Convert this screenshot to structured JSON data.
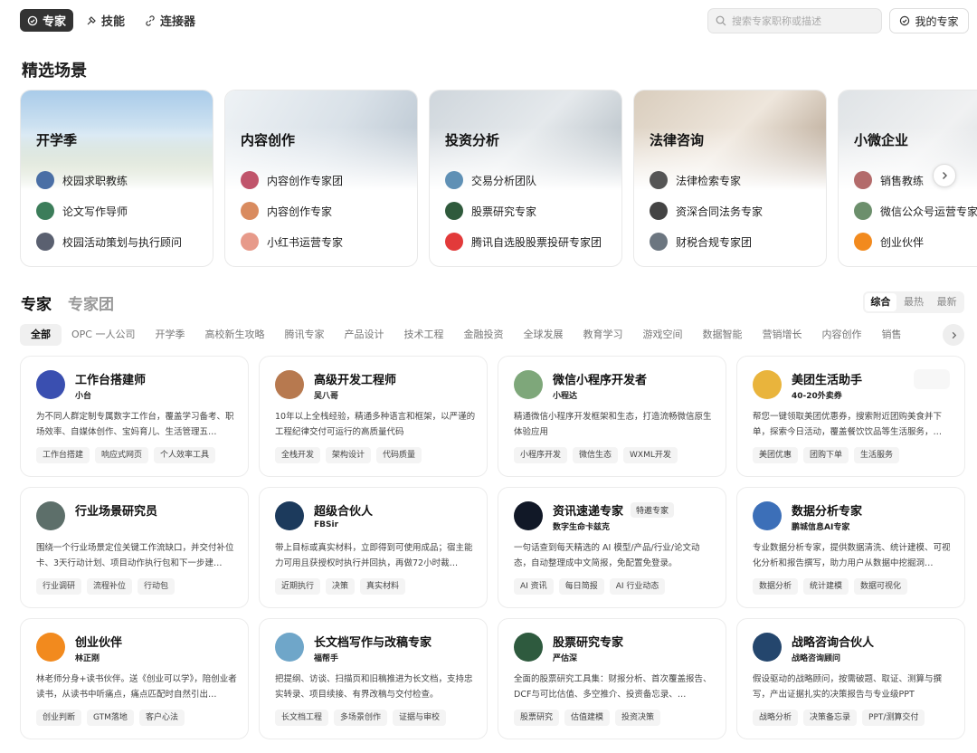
{
  "topnav": [
    {
      "label": "专家",
      "icon": "expert-icon",
      "active": true
    },
    {
      "label": "技能",
      "icon": "skill-icon",
      "active": false
    },
    {
      "label": "连接器",
      "icon": "link-icon",
      "active": false
    }
  ],
  "search": {
    "placeholder": "搜索专家职称或描述"
  },
  "my_experts": {
    "label": "我的专家"
  },
  "featured": {
    "title": "精选场景",
    "scenes": [
      {
        "title": "开学季",
        "items": [
          "校园求职教练",
          "论文写作导师",
          "校园活动策划与执行顾问"
        ]
      },
      {
        "title": "内容创作",
        "items": [
          "内容创作专家团",
          "内容创作专家",
          "小红书运营专家"
        ]
      },
      {
        "title": "投资分析",
        "items": [
          "交易分析团队",
          "股票研究专家",
          "腾讯自选股股票投研专家团"
        ]
      },
      {
        "title": "法律咨询",
        "items": [
          "法律检索专家",
          "资深合同法务专家",
          "财税合规专家团"
        ]
      },
      {
        "title": "小微企业",
        "items": [
          "销售教练",
          "微信公众号运营专家",
          "创业伙伴"
        ]
      }
    ]
  },
  "list_tabs": {
    "experts": "专家",
    "teams": "专家团"
  },
  "sort": {
    "overall": "综合",
    "hot": "最热",
    "newest": "最新"
  },
  "categories": [
    "全部",
    "OPC 一人公司",
    "开学季",
    "高校新生攻略",
    "腾讯专家",
    "产品设计",
    "技术工程",
    "金融投资",
    "全球发展",
    "教育学习",
    "游戏空间",
    "数据智能",
    "营销增长",
    "内容创作",
    "销售"
  ],
  "experts": [
    {
      "name": "工作台搭建师",
      "sub": "小台",
      "desc": "为不同人群定制专属数字工作台，覆盖学习备考、职场效率、自媒体创作、宝妈育儿、生活管理五…",
      "tags": [
        "工作台搭建",
        "响应式网页",
        "个人效率工具"
      ]
    },
    {
      "name": "高级开发工程师",
      "sub": "吴八哥",
      "desc": "10年以上全栈经验，精通多种语言和框架，以严谨的工程纪律交付可运行的高质量代码",
      "tags": [
        "全栈开发",
        "架构设计",
        "代码质量"
      ]
    },
    {
      "name": "微信小程序开发者",
      "sub": "小程达",
      "desc": "精通微信小程序开发框架和生态，打造流畅微信原生体验应用",
      "tags": [
        "小程序开发",
        "微信生态",
        "WXML开发"
      ]
    },
    {
      "name": "美团生活助手",
      "sub": "40-20外卖券",
      "desc": "帮您一键领取美团优惠券，搜索附近团购美食并下单，探索今日活动，覆盖餐饮饮品等生活服务，…",
      "tags": [
        "美团优惠",
        "团购下单",
        "生活服务"
      ]
    },
    {
      "name": "行业场景研究员",
      "sub": "",
      "desc": "围绕一个行业场景定位关键工作流缺口，并交付补位卡、3天行动计划、项目动作执行包和下一步建…",
      "tags": [
        "行业调研",
        "流程补位",
        "行动包"
      ]
    },
    {
      "name": "超级合伙人",
      "sub": "FBSir",
      "desc": "带上目标或真实材料，立即得到可使用成品；宿主能力可用且获授权时执行并回执，再做72小时裁…",
      "tags": [
        "近期执行",
        "决策",
        "真实材料"
      ]
    },
    {
      "name": "资讯速递专家",
      "badge": "特邀专家",
      "sub": "数字生命卡兹克",
      "desc": "一句话查到每天精选的 AI 模型/产品/行业/论文动态，自动整理成中文简报，免配置免登录。",
      "tags": [
        "AI 资讯",
        "每日简报",
        "AI 行业动态"
      ]
    },
    {
      "name": "数据分析专家",
      "sub": "鹏城信息AI专家",
      "desc": "专业数据分析专家，提供数据清洗、统计建模、可视化分析和报告撰写，助力用户从数据中挖掘洞…",
      "tags": [
        "数据分析",
        "统计建模",
        "数据可视化"
      ]
    },
    {
      "name": "创业伙伴",
      "sub": "林正刚",
      "desc": "林老师分身+读书伙伴。送《创业可以学》，陪创业者读书，从读书中听痛点，痛点匹配时自然引出…",
      "tags": [
        "创业判断",
        "GTM落地",
        "客户心法"
      ]
    },
    {
      "name": "长文档写作与改稿专家",
      "sub": "福帮手",
      "desc": "把提纲、访谈、扫描页和旧稿推进为长文档，支持忠实转录、项目续接、有界改稿与交付检查。",
      "tags": [
        "长文档工程",
        "多场景创作",
        "证据与审校"
      ]
    },
    {
      "name": "股票研究专家",
      "sub": "严估深",
      "desc": "全面的股票研究工具集：财报分析、首次覆盖报告、DCF与可比估值、多空推介、投资备忘录、…",
      "tags": [
        "股票研究",
        "估值建模",
        "投资决策"
      ]
    },
    {
      "name": "战略咨询合伙人",
      "sub": "战略咨询顾问",
      "desc": "假设驱动的战略顾问，按需破题、取证、测算与撰写，产出证据扎实的决策报告与专业级PPT",
      "tags": [
        "战略分析",
        "决策备忘录",
        "PPT/测算交付"
      ]
    }
  ]
}
